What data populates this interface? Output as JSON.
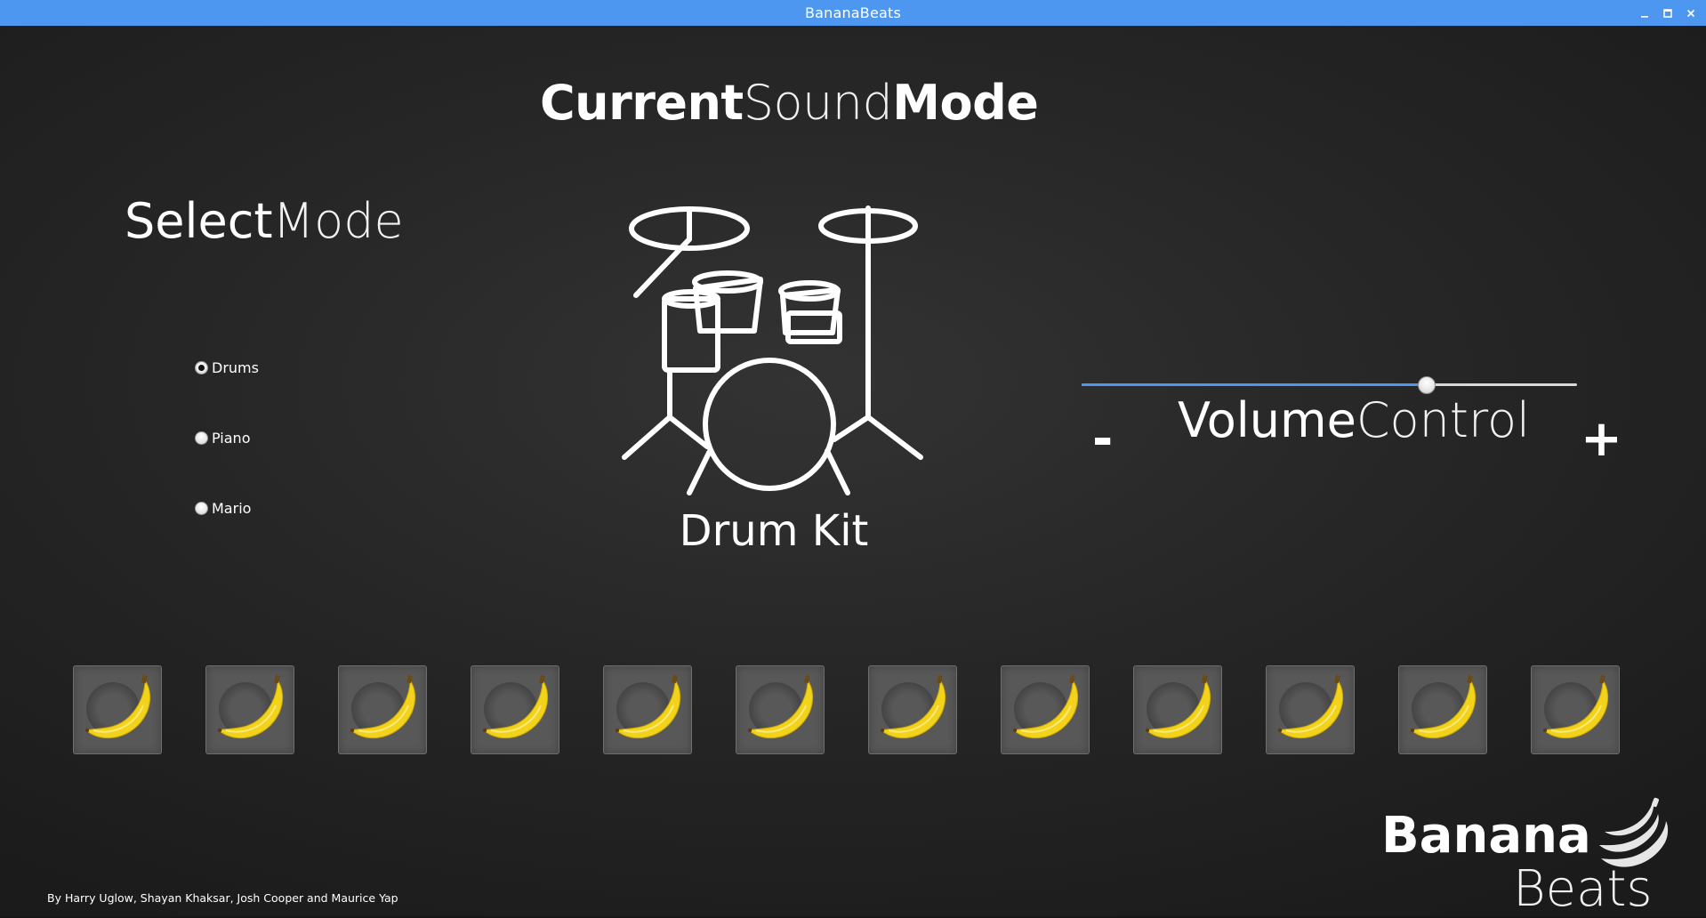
{
  "window": {
    "title": "BananaBeats",
    "controls": [
      "minimize-icon",
      "maximize-icon",
      "close-icon"
    ]
  },
  "current_mode": {
    "title_bold": "Current",
    "title_light": "Sound",
    "title_bold2": "Mode",
    "instrument_icon": "drum-kit-icon",
    "instrument_label": "Drum Kit"
  },
  "select_mode": {
    "title_bold": "Select",
    "title_light": "Mode",
    "options": [
      {
        "label": "Drums",
        "selected": true
      },
      {
        "label": "Piano",
        "selected": false
      },
      {
        "label": "Mario",
        "selected": false
      }
    ]
  },
  "volume": {
    "title_bold": "Volume",
    "title_light": "Control",
    "minus_label": "-",
    "plus_label": "+",
    "level_fraction": 0.697,
    "track_color": "#4d97f0"
  },
  "pads": {
    "icon": "banana-icon",
    "count": 12
  },
  "footer": {
    "credits": "By Harry Uglow, Shayan Khaksar, Josh Cooper and Maurice Yap",
    "logo_word1": "Banana",
    "logo_word2": "Beats",
    "logo_icon": "banana-bunch-icon"
  },
  "colors": {
    "titlebar": "#4d97f0",
    "background": "#2a2a2a",
    "pad": "#585858",
    "banana": "#f2d21b"
  }
}
